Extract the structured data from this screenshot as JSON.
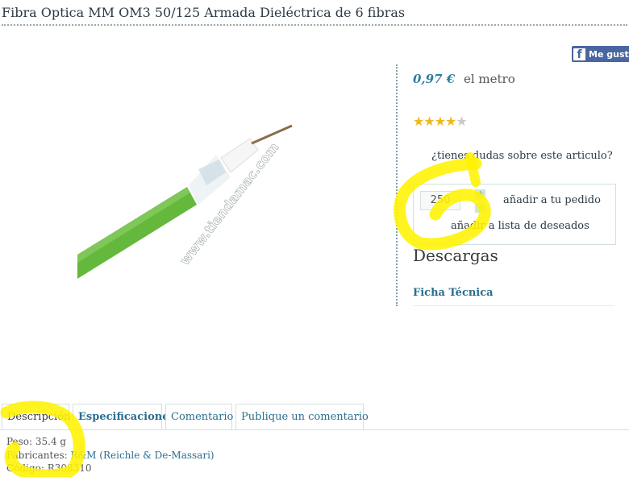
{
  "product": {
    "title": "Fibra Optica MM OM3 50/125 Armada Dieléctrica de 6 fibras",
    "watermark": "www.tiendamac.com"
  },
  "social": {
    "like_label": "Me gusta",
    "icon": "facebook-icon"
  },
  "pricing": {
    "amount": "0,97 €",
    "unit": "el metro"
  },
  "rating": {
    "stars_filled": 4,
    "stars_total": 5,
    "filled_glyph": "★★★★",
    "empty_glyph": "★"
  },
  "question_link": "¿tienes dudas sobre este articulo?",
  "cart": {
    "quantity": "250",
    "increment": "+",
    "decrement": "–",
    "add_label": "añadir a tu pedido",
    "wishlist_label": "añadir a lista de deseados"
  },
  "downloads": {
    "heading": "Descargas",
    "items": [
      "Ficha Técnica"
    ]
  },
  "tabs": [
    {
      "label": "Descripción",
      "active": true
    },
    {
      "label": "Especificaciones",
      "active": false
    },
    {
      "label": "Comentario",
      "active": false
    },
    {
      "label": "Publique un comentario",
      "active": false
    }
  ],
  "specs": {
    "weight": "Peso: 35.4 g",
    "manufacturer_prefix": "Fabricantes: ",
    "manufacturer": "R&M (Reichle & De-Massari)",
    "code": "Código: R308310"
  },
  "colors": {
    "link": "#2a6e8e",
    "price": "#2d7fa0",
    "star": "#f0b81d",
    "cable_green": "#64b83c",
    "highlighter": "#fff200"
  }
}
